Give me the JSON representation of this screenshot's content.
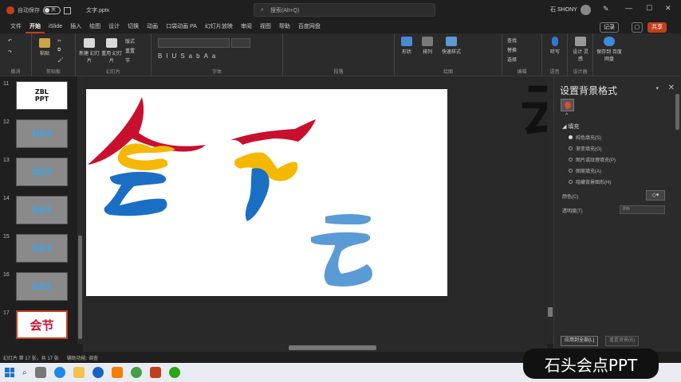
{
  "titlebar": {
    "autosave_label": "自动保存",
    "toggle_label": "关",
    "filename": "文字.pptx",
    "search_placeholder": "搜索(Alt+Q)",
    "user_name": "石 SHONY"
  },
  "tabs": [
    "文件",
    "开始",
    "iSlide",
    "插入",
    "绘图",
    "设计",
    "切换",
    "动画",
    "口袋动画 PA",
    "幻灯片放映",
    "审阅",
    "视图",
    "帮助",
    "百度网盘"
  ],
  "active_tab": "开始",
  "ribbon": {
    "record_label": "记录",
    "share_label": "共享",
    "groups": {
      "undo": "撤消",
      "clipboard": "剪贴板",
      "slides": "幻灯片",
      "font": "字体",
      "paragraph": "段落",
      "drawing": "绘图",
      "editing": "编辑",
      "voice": "语音",
      "designer": "设计器"
    },
    "buttons": {
      "paste": "粘贴",
      "new_slide": "新建\n幻灯片",
      "reuse_slides": "重用\n幻灯片",
      "layout": "版式",
      "reset": "重置",
      "section": "节",
      "shapes": "形状",
      "arrange": "排列",
      "quick_styles": "快速样式",
      "find": "查找",
      "replace": "替换",
      "select": "选择",
      "dictate": "听写",
      "designer": "设计\n灵感",
      "save_to_cloud": "保存到\n百度网盘"
    }
  },
  "thumbnails": [
    {
      "num": "11",
      "kind": "white",
      "text": "ZBL\nPPT"
    },
    {
      "num": "12",
      "kind": "gray",
      "text": "bbt"
    },
    {
      "num": "13",
      "kind": "gray",
      "text": "bbt"
    },
    {
      "num": "14",
      "kind": "gray",
      "text": "bbt"
    },
    {
      "num": "15",
      "kind": "gray",
      "text": "bbt"
    },
    {
      "num": "16",
      "kind": "gray",
      "text": "bbt"
    },
    {
      "num": "17",
      "kind": "selected",
      "text": "会节"
    }
  ],
  "slide": {
    "colors": {
      "red": "#c8102e",
      "yellow": "#f5b800",
      "blue": "#1a6fc4",
      "light_blue": "#5b9bd5"
    }
  },
  "pane": {
    "title": "设置背景格式",
    "section": "填充",
    "options": [
      "纯色填充(S)",
      "渐变填充(G)",
      "图片或纹理填充(P)",
      "图案填充(A)",
      "隐藏背景图形(H)"
    ],
    "color_label": "颜色(C)",
    "transparency_label": "透明度(T)",
    "transparency_value": "0%",
    "apply_all": "应用到全部(L)",
    "reset_bg": "重置背景(B)"
  },
  "status": {
    "slide_info": "幻灯片 第 17 张，共 17 张",
    "accessibility": "辅助功能: 调查"
  },
  "watermark": "石头会点PPT"
}
